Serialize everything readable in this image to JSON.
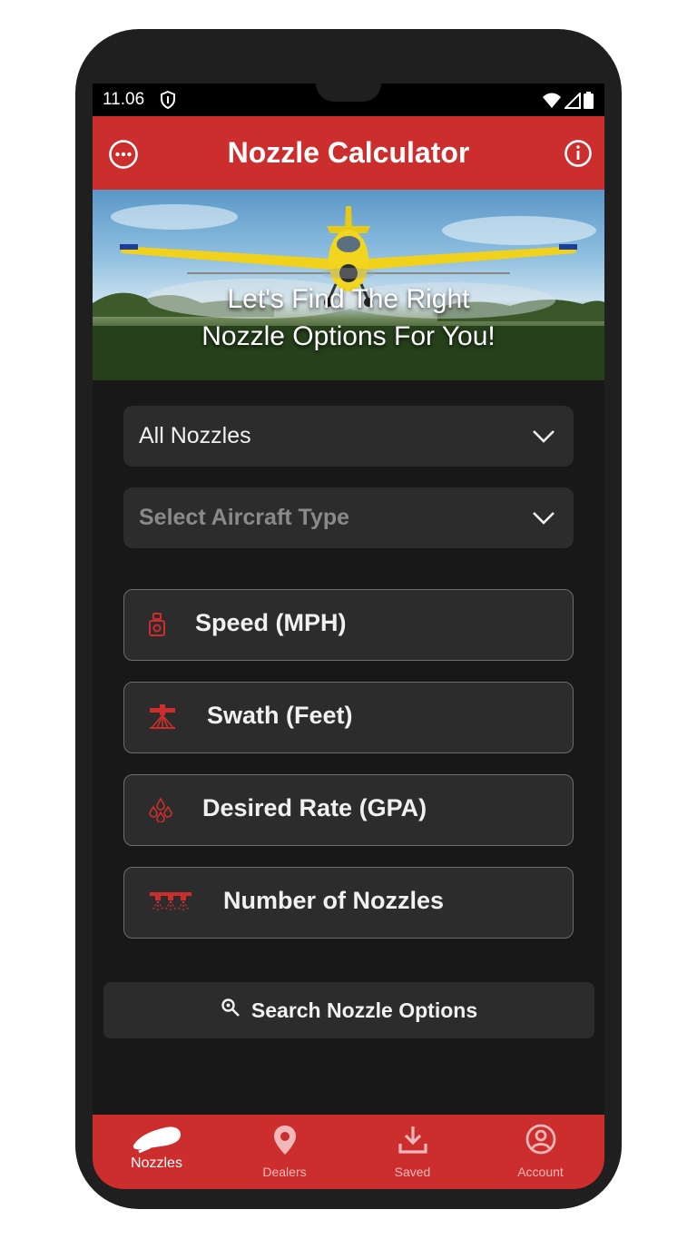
{
  "status_bar": {
    "time": "11.06"
  },
  "header": {
    "title": "Nozzle Calculator",
    "left_icon": "more-horizontal-circle-icon",
    "right_icon": "info-icon"
  },
  "hero": {
    "line1": "Let's Find The Right",
    "line2": "Nozzle Options For You!"
  },
  "dropdowns": [
    {
      "value": "All Nozzles",
      "is_placeholder": false
    },
    {
      "value": "Select Aircraft Type",
      "is_placeholder": true
    }
  ],
  "fields": [
    {
      "label": "Speed (MPH)",
      "icon": "speedometer-icon"
    },
    {
      "label": "Swath (Feet)",
      "icon": "swath-boom-icon"
    },
    {
      "label": "Desired Rate (GPA)",
      "icon": "droplets-icon"
    },
    {
      "label": "Number of Nozzles",
      "icon": "nozzle-boom-icon"
    }
  ],
  "search_button": {
    "label": "Search Nozzle Options"
  },
  "bottom_nav": [
    {
      "label": "Nozzles",
      "active": true
    },
    {
      "label": "Dealers",
      "active": false
    },
    {
      "label": "Saved",
      "active": false
    },
    {
      "label": "Account",
      "active": false
    }
  ],
  "colors": {
    "accent": "#cc2e2e",
    "background": "#181818",
    "surface": "#2c2c2c",
    "text": "#f1f1f1",
    "placeholder": "#8a8a8a",
    "nav_inactive": "#f0b8b8"
  }
}
